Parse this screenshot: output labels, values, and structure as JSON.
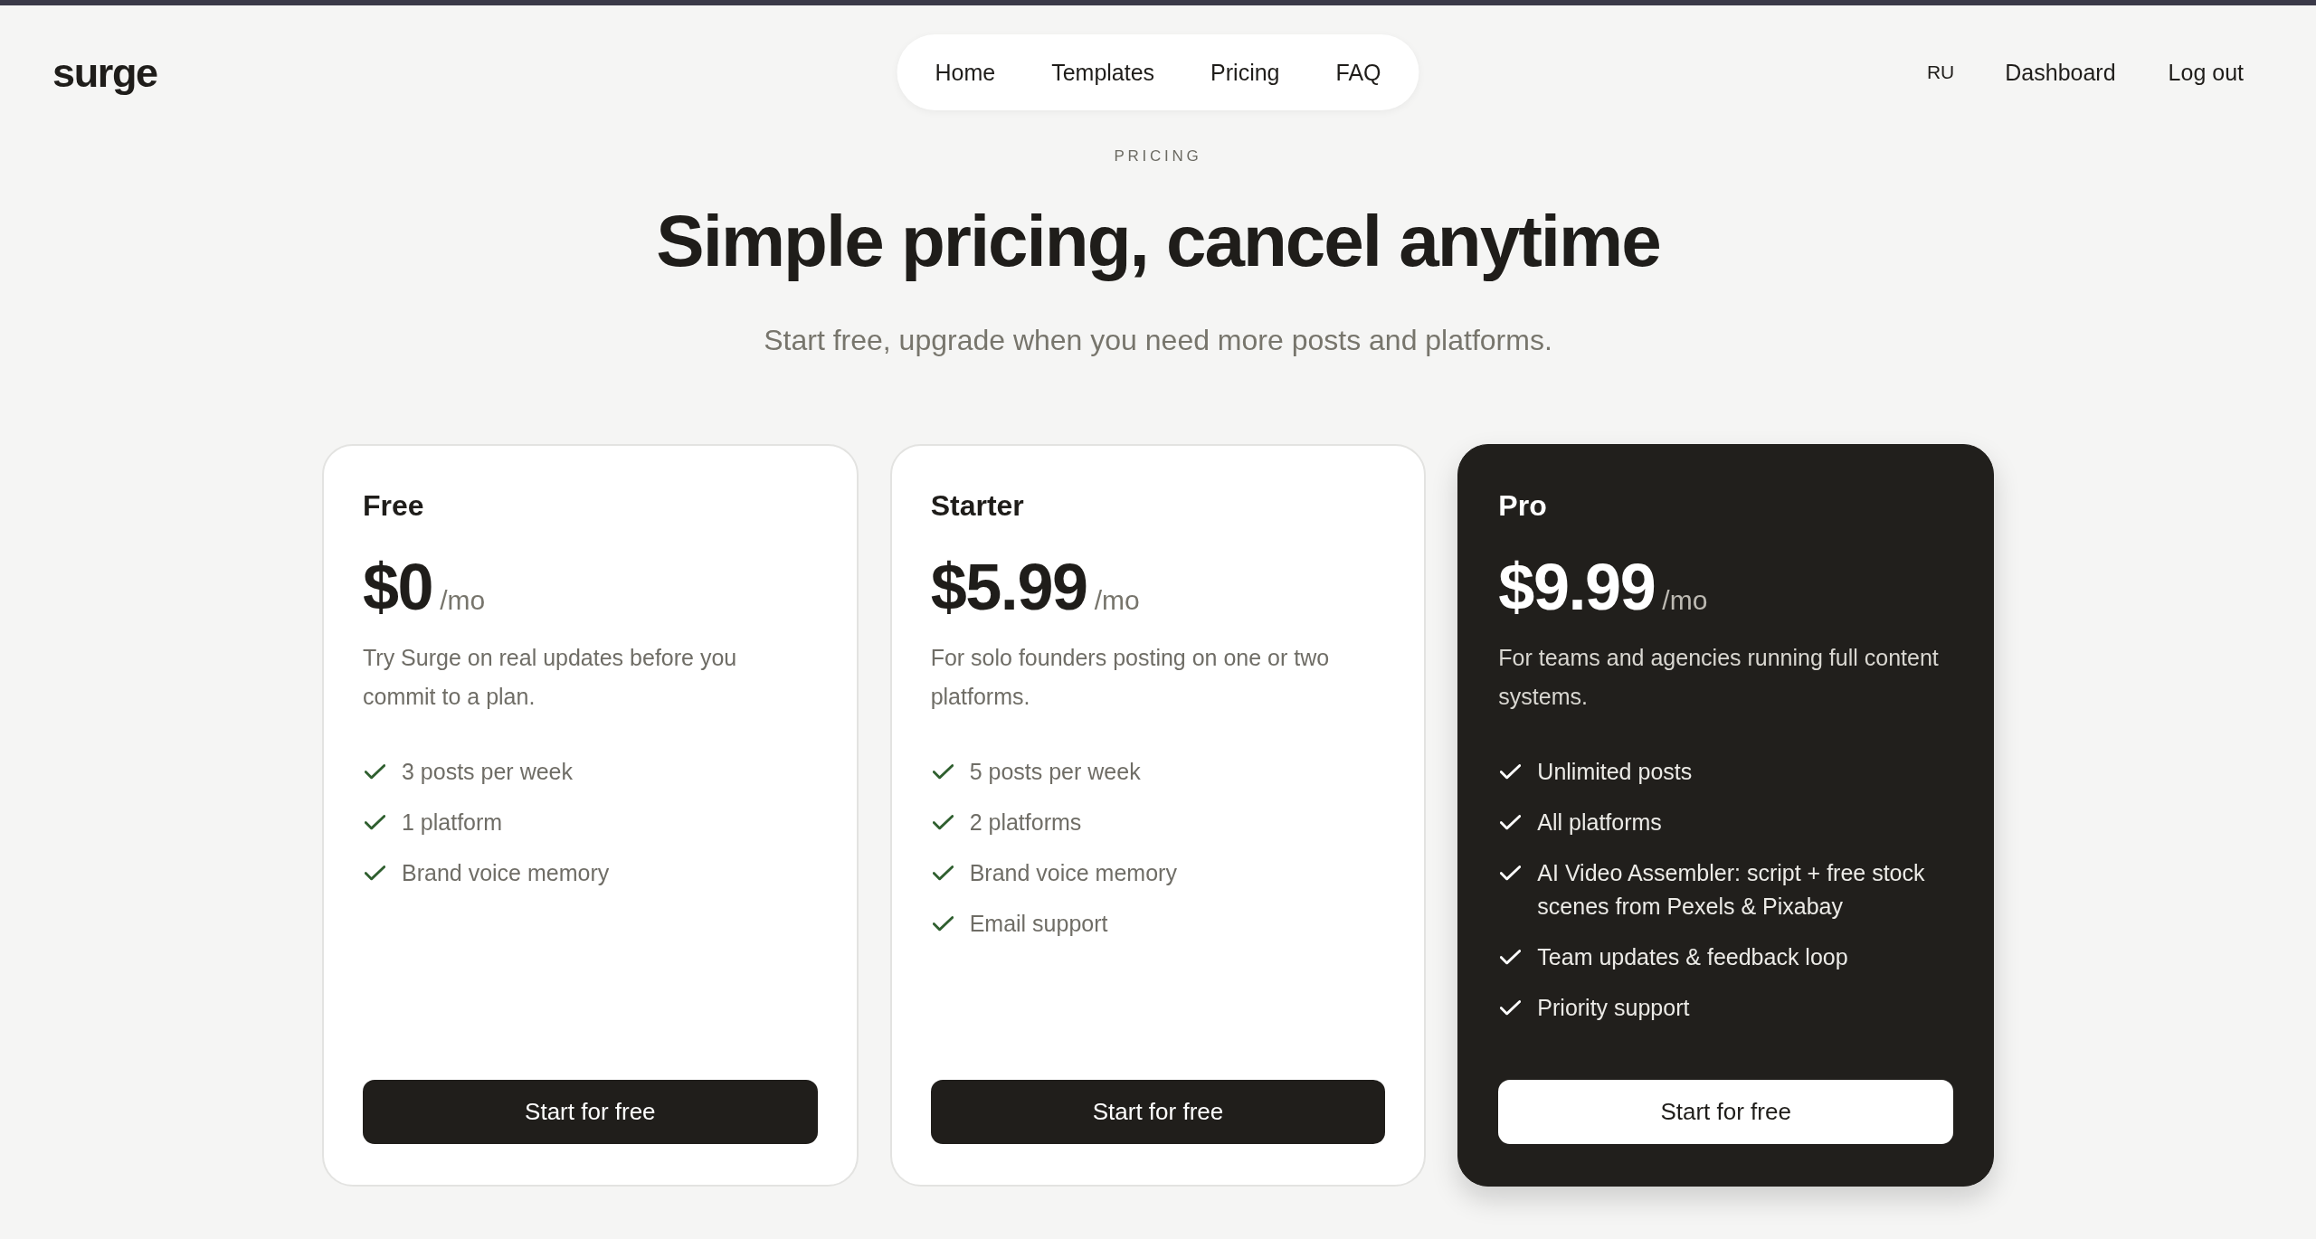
{
  "logo": "surge",
  "nav": [
    {
      "label": "Home"
    },
    {
      "label": "Templates"
    },
    {
      "label": "Pricing"
    },
    {
      "label": "FAQ"
    }
  ],
  "language": "RU",
  "account_links": [
    {
      "label": "Dashboard"
    },
    {
      "label": "Log out"
    }
  ],
  "hero": {
    "eyebrow": "PRICING",
    "title": "Simple pricing, cancel anytime",
    "subtitle": "Start free, upgrade when you need more posts and platforms."
  },
  "plans": [
    {
      "name": "Free",
      "price": "$0",
      "period": "/mo",
      "description": "Try Surge on real updates before you commit to a plan.",
      "features": [
        "3 posts per week",
        "1 platform",
        "Brand voice memory"
      ],
      "button": "Start for free",
      "highlighted": false
    },
    {
      "name": "Starter",
      "price": "$5.99",
      "period": "/mo",
      "description": "For solo founders posting on one or two platforms.",
      "features": [
        "5 posts per week",
        "2 platforms",
        "Brand voice memory",
        "Email support"
      ],
      "button": "Start for free",
      "highlighted": false
    },
    {
      "name": "Pro",
      "price": "$9.99",
      "period": "/mo",
      "description": "For teams and agencies running full content systems.",
      "features": [
        "Unlimited posts",
        "All platforms",
        "AI Video Assembler: script + free stock scenes from Pexels & Pixabay",
        "Team updates & feedback loop",
        "Priority support"
      ],
      "button": "Start for free",
      "highlighted": true
    }
  ]
}
